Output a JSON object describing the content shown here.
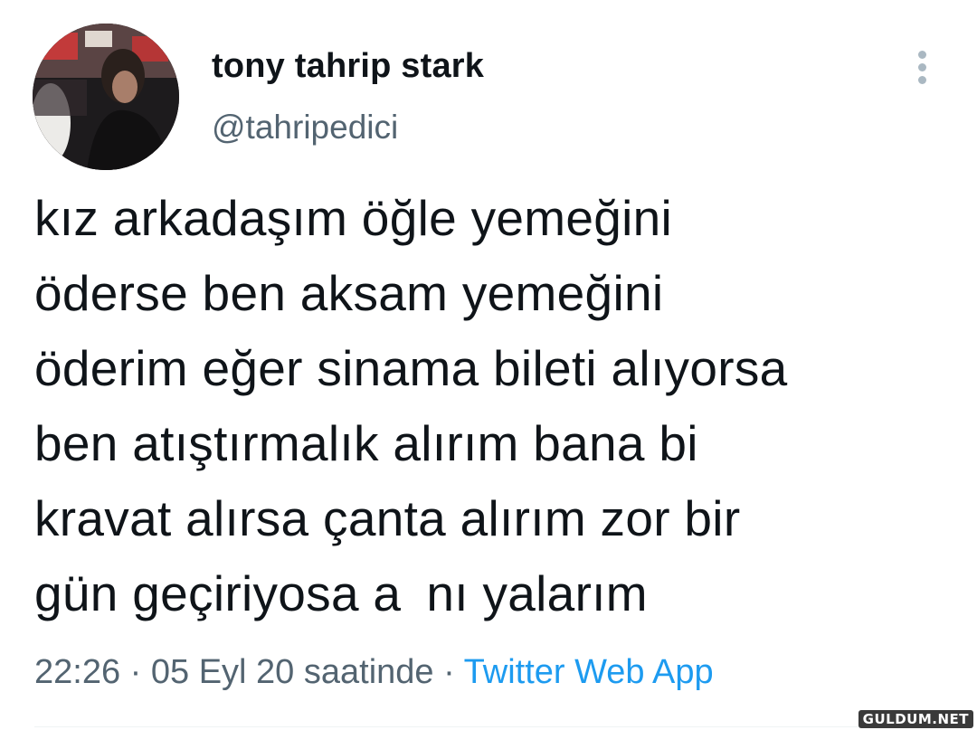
{
  "author": {
    "display_name": "tony tahrip stark",
    "handle": "@tahripedici",
    "avatar_icon": "profile-photo"
  },
  "menu": {
    "icon": "more-vertical-icon"
  },
  "tweet": {
    "lines": [
      "kız arkadaşım öğle yemeğini",
      "öderse ben aksam yemeğini",
      "öderim eğer sinama bileti alıyorsa",
      "ben atıştırmalık alırım bana bi",
      "kravat alırsa çanta alırım zor bir",
      "gün geçiriyosa a  nı yalarım"
    ]
  },
  "meta": {
    "time": "22:26",
    "separator1": " · ",
    "date": "05 Eyl 20 saatinde",
    "separator2": " · ",
    "source": "Twitter Web App"
  },
  "watermark": {
    "text": "GULDUM.NET"
  },
  "colors": {
    "text": "#0f1419",
    "secondary": "#536471",
    "link": "#1d9bf0"
  }
}
